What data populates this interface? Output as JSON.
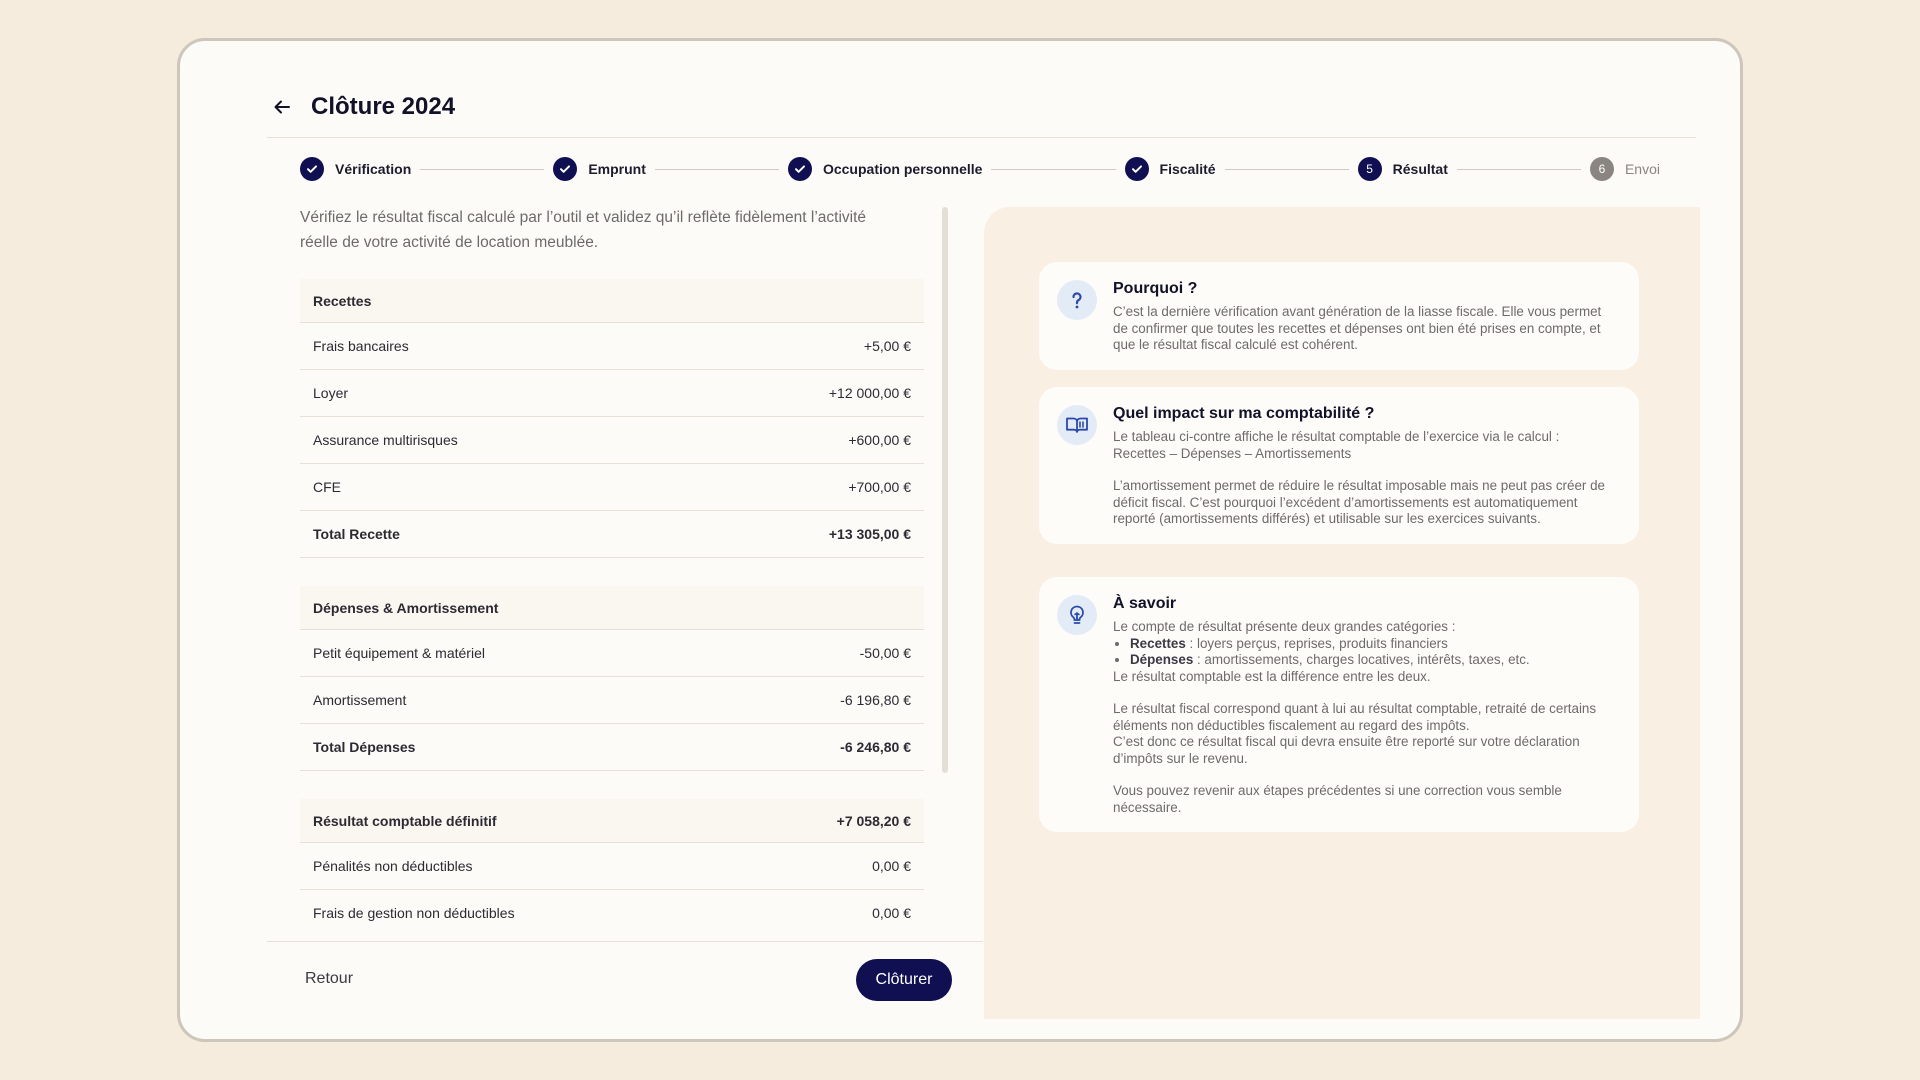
{
  "header": {
    "title": "Clôture 2024"
  },
  "steps": [
    {
      "label": "Vérification",
      "status": "done"
    },
    {
      "label": "Emprunt",
      "status": "done"
    },
    {
      "label": "Occupation personnelle",
      "status": "done"
    },
    {
      "label": "Fiscalité",
      "status": "done"
    },
    {
      "label": "Résultat",
      "number": "5",
      "status": "current"
    },
    {
      "label": "Envoi",
      "number": "6",
      "status": "pending"
    }
  ],
  "intro": "Vérifiez le résultat fiscal calculé par l’outil et validez qu’il reflète fidèlement l’activité réelle de votre activité de location meublée.",
  "recettes": {
    "title": "Recettes",
    "rows": [
      {
        "label": "Frais bancaires",
        "value": "+5,00 €"
      },
      {
        "label": "Loyer",
        "value": "+12 000,00 €"
      },
      {
        "label": "Assurance multirisques",
        "value": "+600,00 €"
      },
      {
        "label": "CFE",
        "value": "+700,00 €"
      }
    ],
    "total": {
      "label": "Total Recette",
      "value": "+13 305,00 €"
    }
  },
  "depenses": {
    "title": "Dépenses & Amortissement",
    "rows": [
      {
        "label": "Petit équipement & matériel",
        "value": "-50,00 €"
      },
      {
        "label": "Amortissement",
        "value": "-6 196,80 €"
      }
    ],
    "total": {
      "label": "Total Dépenses",
      "value": "-6 246,80 €"
    }
  },
  "resultat": {
    "title": "Résultat comptable définitif",
    "value": "+7 058,20 €",
    "rows": [
      {
        "label": "Pénalités non déductibles",
        "value": "0,00 €"
      },
      {
        "label": "Frais de gestion non déductibles",
        "value": "0,00 €"
      }
    ]
  },
  "footer": {
    "back_label": "Retour",
    "submit_label": "Clôturer"
  },
  "info": {
    "pourquoi": {
      "title": "Pourquoi ?",
      "text": "C’est la dernière vérification avant génération de la liasse fiscale. Elle vous permet de confirmer que toutes les recettes et dépenses ont bien été prises en compte, et que le résultat fiscal calculé est cohérent."
    },
    "impact": {
      "title": "Quel impact sur ma comptabilité ?",
      "p1a": "Le tableau ci-contre affiche le résultat comptable de l’exercice via le calcul :",
      "p1b": "Recettes – Dépenses – Amortissements",
      "p2": "L’amortissement permet de réduire le résultat imposable mais ne peut pas créer de déficit fiscal. C’est pourquoi l’excédent d’amortissements est automatiquement reporté (amortissements différés) et utilisable sur les exercices suivants."
    },
    "savoir": {
      "title": "À savoir",
      "intro": "Le compte de résultat présente deux grandes catégories :",
      "b1_label": "Recettes",
      "b1_text": " : loyers perçus, reprises, produits financiers",
      "b2_label": "Dépenses",
      "b2_text": " : amortissements, charges locatives, intérêts, taxes, etc.",
      "p2": "Le résultat comptable est la différence entre les deux.",
      "p3a": "Le résultat fiscal correspond quant à lui au résultat comptable, retraité de certains éléments non déductibles fiscalement au regard des impôts.",
      "p3b": "C’est donc ce résultat fiscal qui devra ensuite être reporté sur votre déclaration d’impôts sur le revenu.",
      "p4": "Vous pouvez revenir aux étapes précédentes si une correction vous semble nécessaire."
    }
  },
  "colors": {
    "primary": "#0f0f52",
    "background": "#f5ecdd",
    "panel": "#f9efe3",
    "pending": "#8a8580"
  },
  "icons": {
    "back": "arrow-left-icon",
    "done": "check-icon",
    "pourquoi": "question-icon",
    "impact": "book-icon",
    "savoir": "lightbulb-icon"
  }
}
